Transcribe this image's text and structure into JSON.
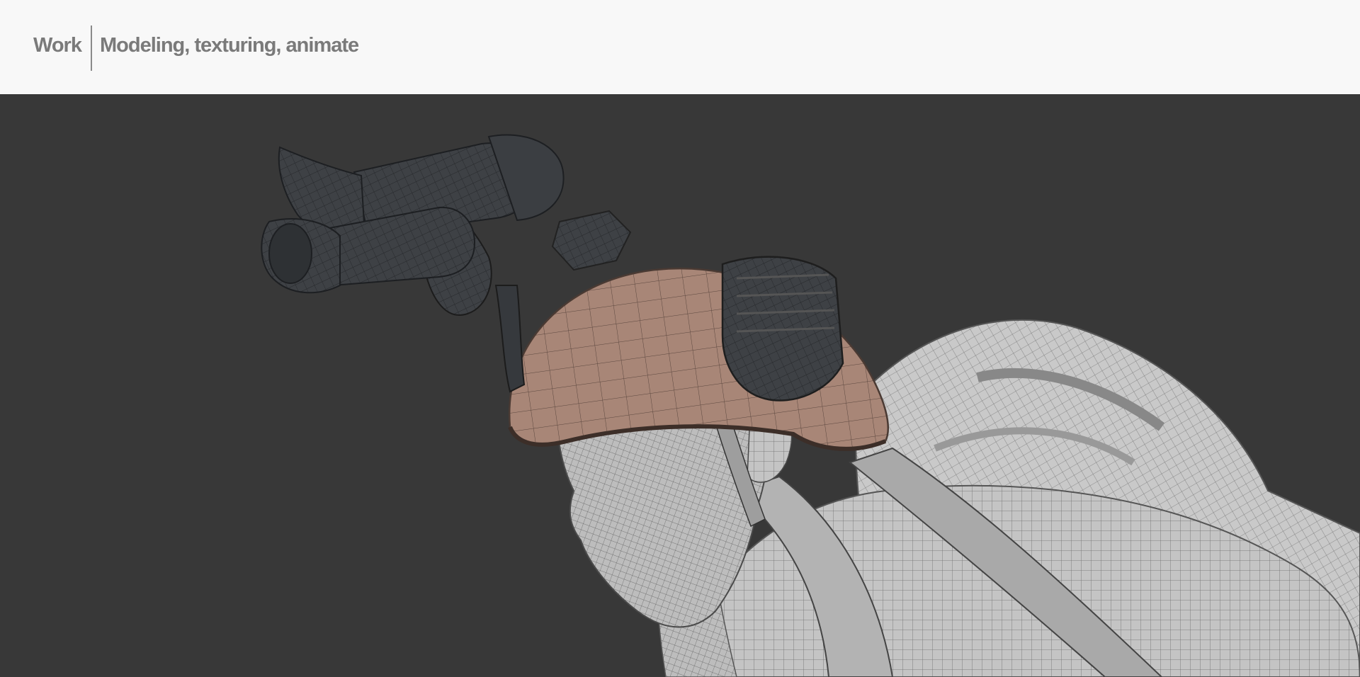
{
  "header": {
    "brand": "Work",
    "section_title": "Modeling, texturing, animate"
  },
  "viewport": {
    "image_subject": "wireframe-render-soldier-helmet-night-vision",
    "colors": {
      "background": "#383838",
      "helmet": "#a88677",
      "mesh_body": "#c4c4c4",
      "goggles": "#3c3f43",
      "wire": "#2a2a2a"
    }
  }
}
